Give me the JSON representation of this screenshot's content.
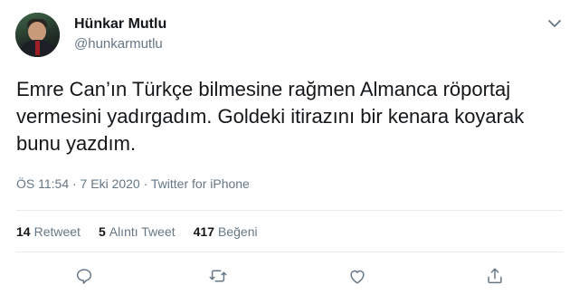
{
  "user": {
    "name": "Hünkar Mutlu",
    "handle": "@hunkarmutlu"
  },
  "tweet": {
    "text": "Emre Can’ın Türkçe bilmesine rağmen Almanca röportaj vermesini yadırgadım. Goldeki itirazını bir kenara koyarak bunu yazdım.",
    "timestamp": "ÖS 11:54 · 7 Eki 2020 · Twitter for iPhone"
  },
  "stats": {
    "retweets_count": "14",
    "retweets_label": "Retweet",
    "quotes_count": "5",
    "quotes_label": "Alıntı Tweet",
    "likes_count": "417",
    "likes_label": "Beğeni"
  },
  "icons": {
    "reply": "reply-icon",
    "retweet": "retweet-icon",
    "like": "heart-icon",
    "share": "share-icon",
    "more": "chevron-down-icon"
  },
  "colors": {
    "text": "#14171a",
    "secondary": "#657786",
    "divider": "#e6ecf0"
  }
}
